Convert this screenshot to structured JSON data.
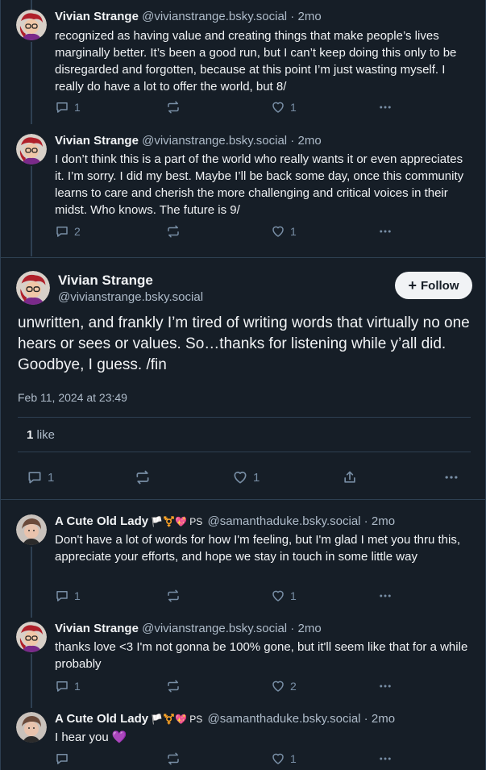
{
  "posts_above": [
    {
      "name": "Vivian Strange",
      "handle": "@vivianstrange.bsky.social",
      "time": "2mo",
      "text": "recognized as having value and creating things that make people’s lives marginally better. It’s been a good run, but I can’t keep doing this only to be disregarded and forgotten, because at this point I’m just wasting myself. I really do have a lot to offer the world, but 8/",
      "replies": "1",
      "reposts": "",
      "likes": "1"
    },
    {
      "name": "Vivian Strange",
      "handle": "@vivianstrange.bsky.social",
      "time": "2mo",
      "text": "I don’t think this is a part of the world who really wants it or even appreciates it. I’m sorry. I did my best. Maybe I’ll be back some day, once this community learns to care and cherish the more challenging and critical voices in their midst. Who knows. The future is 9/",
      "replies": "2",
      "reposts": "",
      "likes": "1"
    }
  ],
  "main_post": {
    "name": "Vivian Strange",
    "handle": "@vivianstrange.bsky.social",
    "follow_label": "Follow",
    "text": "unwritten, and frankly I’m tired of writing words that virtually no one hears or sees or values. So…thanks for listening while y’all did. Goodbye, I guess. /fin",
    "date": "Feb 11, 2024 at 23:49",
    "like_count": "1",
    "like_word": "like",
    "replies": "1",
    "reposts": "",
    "likes": "1"
  },
  "replies_below": [
    {
      "name": "A Cute Old Lady",
      "flags": "🏳️⚧️💖 PS",
      "handle": "@samanthaduke.bsky.social",
      "time": "2mo",
      "text": "Don't have a lot of words for how I'm feeling, but I'm glad I met you thru this, appreciate your efforts, and hope we stay in touch in some little way",
      "replies": "1",
      "reposts": "",
      "likes": "1"
    },
    {
      "name": "Vivian Strange",
      "flags": "",
      "handle": "@vivianstrange.bsky.social",
      "time": "2mo",
      "text": "thanks love <3 I'm not gonna be 100% gone, but it'll seem like that for a while probably",
      "replies": "1",
      "reposts": "",
      "likes": "2"
    },
    {
      "name": "A Cute Old Lady",
      "flags": "🏳️⚧️💖 PS",
      "handle": "@samanthaduke.bsky.social",
      "time": "2mo",
      "text": "I hear you 💜",
      "replies": "",
      "reposts": "",
      "likes": "1"
    }
  ],
  "time_separator": " · ",
  "colors": {
    "background": "#161e27",
    "text": "#f1f3f5",
    "muted": "#aebbc9",
    "icon": "#788ea5",
    "border": "#2e4052"
  }
}
